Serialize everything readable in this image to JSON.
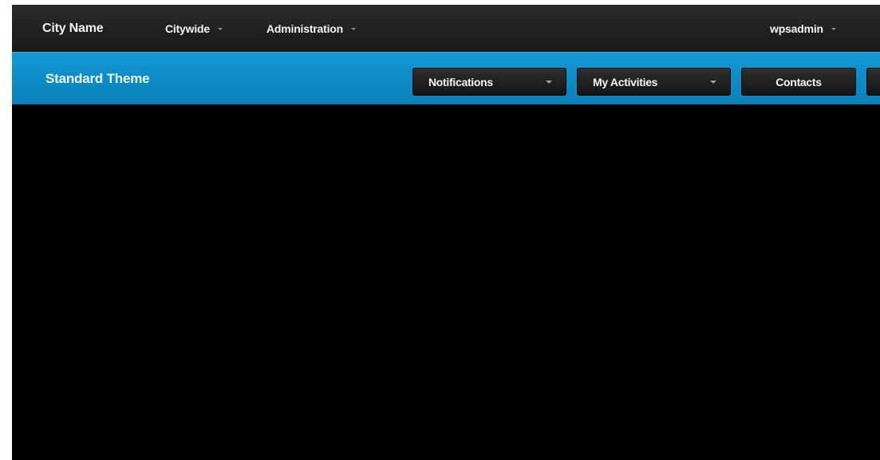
{
  "topbar": {
    "brand": "City Name",
    "menus": [
      {
        "label": "Citywide"
      },
      {
        "label": "Administration"
      }
    ],
    "user": {
      "label": "wpsadmin"
    }
  },
  "themebar": {
    "title": "Standard Theme",
    "buttons": [
      {
        "label": "Notifications",
        "dropdown": true
      },
      {
        "label": "My Activities",
        "dropdown": true
      },
      {
        "label": "Contacts",
        "dropdown": false
      }
    ]
  },
  "colors": {
    "topbar_bg": "#1f1f1f",
    "theme_bar_bg": "#1190cc",
    "button_bg": "#1e1e1e",
    "content_bg": "#000000"
  },
  "icons": {
    "dropdown": "chevron-down-icon"
  }
}
